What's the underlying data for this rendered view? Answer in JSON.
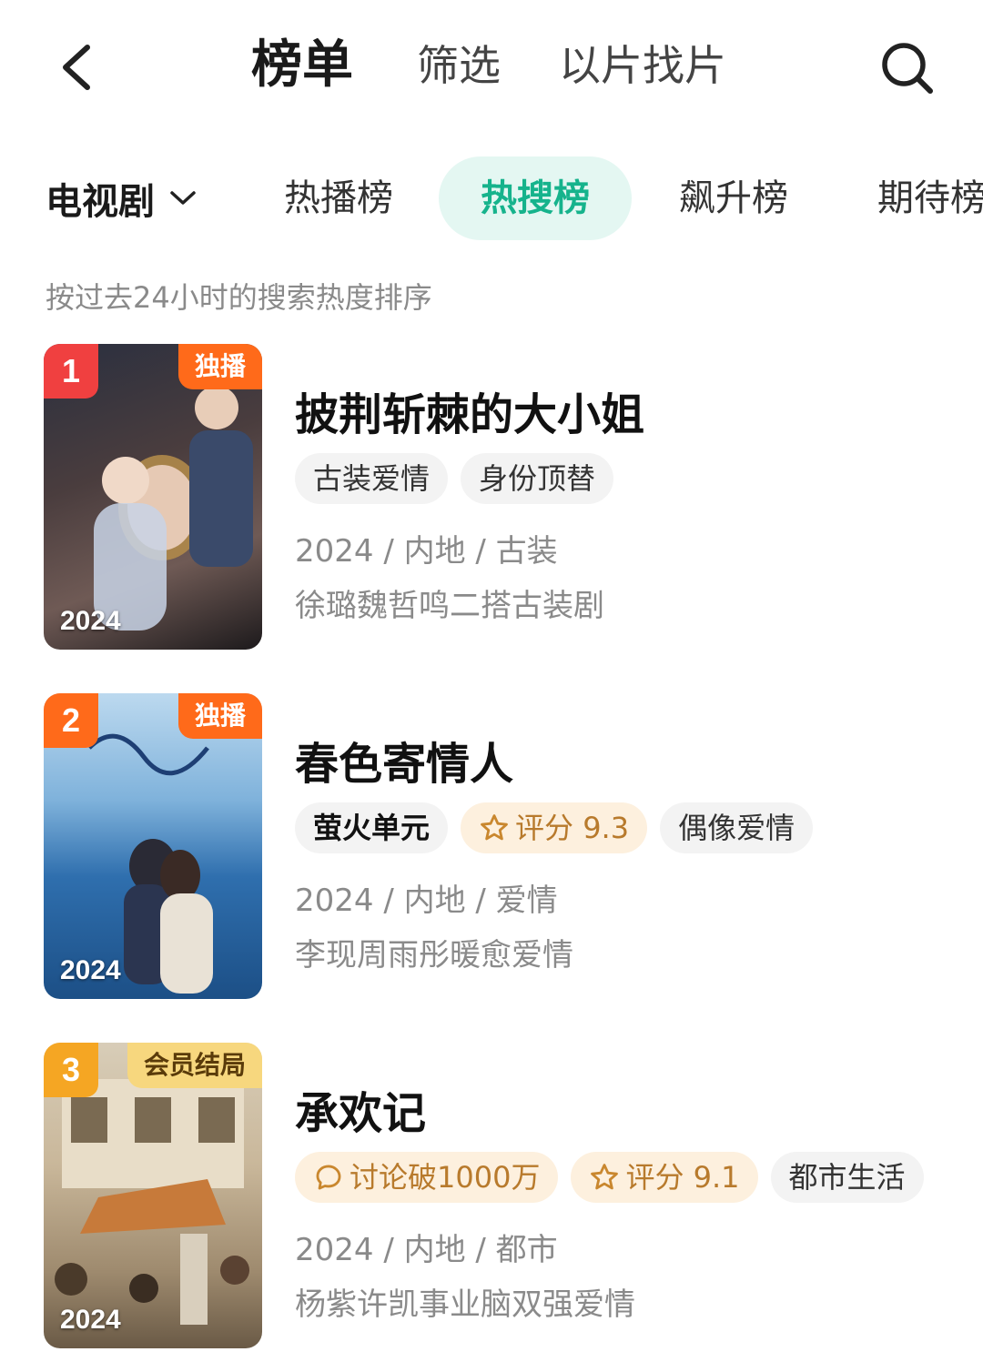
{
  "header": {
    "tabs": [
      {
        "label": "榜单",
        "active": true
      },
      {
        "label": "筛选",
        "active": false
      },
      {
        "label": "以片找片",
        "active": false
      }
    ]
  },
  "category": {
    "selected": "电视剧",
    "rank_tabs": [
      {
        "label": "热播榜",
        "active": false
      },
      {
        "label": "热搜榜",
        "active": true
      },
      {
        "label": "飙升榜",
        "active": false
      },
      {
        "label": "期待榜",
        "active": false
      }
    ]
  },
  "subtitle": "按过去24小时的搜索热度排序",
  "items": [
    {
      "rank": "1",
      "rank_color": "#f04040",
      "corner_label": "独播",
      "corner_bg": "#ff6a1a",
      "corner_fg": "#ffffff",
      "year": "2024",
      "title": "披荆斩棘的大小姐",
      "tags": [
        {
          "text": "古装爱情",
          "style": "plain",
          "icon": ""
        },
        {
          "text": "身份顶替",
          "style": "plain",
          "icon": ""
        }
      ],
      "meta": "2024 / 内地 / 古装",
      "desc": "徐璐魏哲鸣二搭古装剧"
    },
    {
      "rank": "2",
      "rank_color": "#ff6a1a",
      "corner_label": "独播",
      "corner_bg": "#ff6a1a",
      "corner_fg": "#ffffff",
      "year": "2024",
      "title": "春色寄情人",
      "tags": [
        {
          "text": "萤火单元",
          "style": "plain",
          "icon": ""
        },
        {
          "text": "评分 9.3",
          "style": "warm",
          "icon": "star-icon"
        },
        {
          "text": "偶像爱情",
          "style": "plain",
          "icon": ""
        }
      ],
      "meta": "2024 / 内地 / 爱情",
      "desc": "李现周雨彤暖愈爱情"
    },
    {
      "rank": "3",
      "rank_color": "#f5a623",
      "corner_label": "会员结局",
      "corner_bg": "#f7d77e",
      "corner_fg": "#5a3b0a",
      "year": "2024",
      "title": "承欢记",
      "tags": [
        {
          "text": "讨论破1000万",
          "style": "warm",
          "icon": "comment-icon"
        },
        {
          "text": "评分 9.1",
          "style": "warm",
          "icon": "star-icon"
        },
        {
          "text": "都市生活",
          "style": "plain",
          "icon": ""
        }
      ],
      "meta": "2024 / 内地 / 都市",
      "desc": "杨紫许凯事业脑双强爱情"
    }
  ]
}
